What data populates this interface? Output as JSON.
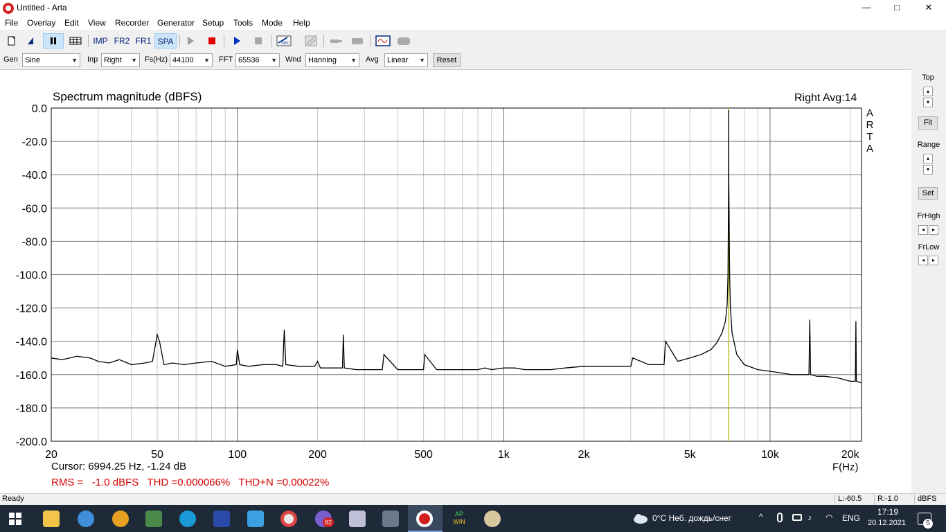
{
  "window": {
    "title": "Untitled - Arta",
    "minimize": "—",
    "maximize": "□",
    "close": "✕"
  },
  "menu": [
    "File",
    "Overlay",
    "Edit",
    "View",
    "Recorder",
    "Generator",
    "Setup",
    "Tools",
    "Mode",
    "Help"
  ],
  "toolbar": {
    "imp": "IMP",
    "fr2": "FR2",
    "fr1": "FR1",
    "spa": "SPA",
    "active_mode": "SPA"
  },
  "controls": {
    "gen_label": "Gen",
    "gen_value": "Sine",
    "inp_label": "Inp",
    "inp_value": "Right",
    "fs_label": "Fs(Hz)",
    "fs_value": "44100",
    "fft_label": "FFT",
    "fft_value": "65536",
    "wnd_label": "Wnd",
    "wnd_value": "Hanning",
    "avg_label": "Avg",
    "avg_value": "Linear",
    "reset_label": "Reset"
  },
  "plot": {
    "title": "Spectrum magnitude (dBFS)",
    "channel_avg": "Right  Avg:14",
    "brand_vertical": [
      "A",
      "R",
      "T",
      "A"
    ],
    "cursor": "Cursor: 6994.25 Hz, -1.24 dB",
    "measurement": "RMS =   -1.0 dBFS   THD =0.000066%   THD+N =0.00022%",
    "x_unit": "F(Hz)"
  },
  "chart_data": {
    "type": "line",
    "title": "Spectrum magnitude (dBFS)",
    "xlabel": "F(Hz)",
    "ylabel": "",
    "x_scale": "log",
    "xlim": [
      20,
      22050
    ],
    "ylim": [
      -200,
      0
    ],
    "grid": true,
    "x_tick_labels": [
      "20",
      "50",
      "100",
      "200",
      "500",
      "1k",
      "2k",
      "5k",
      "10k",
      "20k"
    ],
    "x_tick_values": [
      20,
      50,
      100,
      200,
      500,
      1000,
      2000,
      5000,
      10000,
      20000
    ],
    "y_tick_labels": [
      "0.0",
      "-20.0",
      "-40.0",
      "-60.0",
      "-80.0",
      "-100.0",
      "-120.0",
      "-140.0",
      "-160.0",
      "-180.0",
      "-200.0"
    ],
    "y_tick_values": [
      0,
      -20,
      -40,
      -60,
      -80,
      -100,
      -120,
      -140,
      -160,
      -180,
      -200
    ],
    "cursor_freq": 6994.25,
    "series": [
      {
        "color": "#000000",
        "x": [
          20,
          22,
          25,
          28,
          30,
          33,
          36,
          40,
          45,
          48,
          50,
          51,
          53,
          57,
          63,
          70,
          80,
          90,
          99,
          100,
          102,
          110,
          125,
          140,
          148,
          150,
          152,
          170,
          195,
          200,
          205,
          230,
          248,
          250,
          252,
          280,
          330,
          350,
          355,
          400,
          480,
          500,
          505,
          560,
          650,
          700,
          750,
          800,
          850,
          900,
          1000,
          1100,
          1200,
          1500,
          1700,
          2000,
          2500,
          3000,
          3050,
          3500,
          4000,
          4050,
          4500,
          5000,
          5500,
          6000,
          6300,
          6600,
          6800,
          6900,
          6950,
          6990,
          6994,
          7000,
          7050,
          7100,
          7200,
          7500,
          8000,
          9000,
          10000,
          11000,
          12000,
          13000,
          14000,
          14100,
          14200,
          15000,
          16000,
          18000,
          19000,
          20000,
          20900,
          21000,
          21100,
          22050
        ],
        "y": [
          -150,
          -151,
          -149,
          -150,
          -152,
          -153,
          -151,
          -154,
          -153,
          -152,
          -136,
          -140,
          -154,
          -153,
          -154,
          -153,
          -152,
          -155,
          -154,
          -145,
          -154,
          -155,
          -154,
          -154,
          -155,
          -133,
          -154,
          -155,
          -155,
          -152,
          -156,
          -156,
          -156,
          -136,
          -156,
          -157,
          -157,
          -157,
          -148,
          -157,
          -157,
          -157,
          -148,
          -157,
          -157,
          -157,
          -157,
          -157,
          -156,
          -157,
          -156,
          -156,
          -157,
          -157,
          -156,
          -155,
          -155,
          -155,
          -150,
          -154,
          -154,
          -140,
          -152,
          -150,
          -148,
          -145,
          -141,
          -135,
          -128,
          -118,
          -100,
          -44,
          -1.24,
          -44,
          -100,
          -120,
          -135,
          -148,
          -154,
          -157,
          -158,
          -159,
          -160,
          -160,
          -160,
          -127,
          -160,
          -161,
          -161,
          -162,
          -163,
          -164,
          -164,
          -128,
          -164,
          -165
        ]
      }
    ]
  },
  "right_panel": {
    "top_label": "Top",
    "fit_label": "Fit",
    "range_label": "Range",
    "set_label": "Set",
    "frhigh_label": "FrHigh",
    "frlow_label": "FrLow",
    "up": "▴",
    "down": "▾",
    "left": "◂",
    "right": "▸"
  },
  "statusbar": {
    "ready": "Ready",
    "left_level": "L:-60.5",
    "right_level": "R:-1.0",
    "unit": "dBFS"
  },
  "taskbar": {
    "weather": "0°C  Неб. дождь/снег",
    "lang": "ENG",
    "time": "17:19",
    "date": "20.12.2021",
    "notification_count": "5",
    "badge_count": "82",
    "ap_win_top": "AP",
    "ap_win_bottom": "WIN"
  },
  "colors": {
    "accent": "#d40000",
    "cursor_line": "#b8b800",
    "taskbar": "#1f2a38"
  }
}
